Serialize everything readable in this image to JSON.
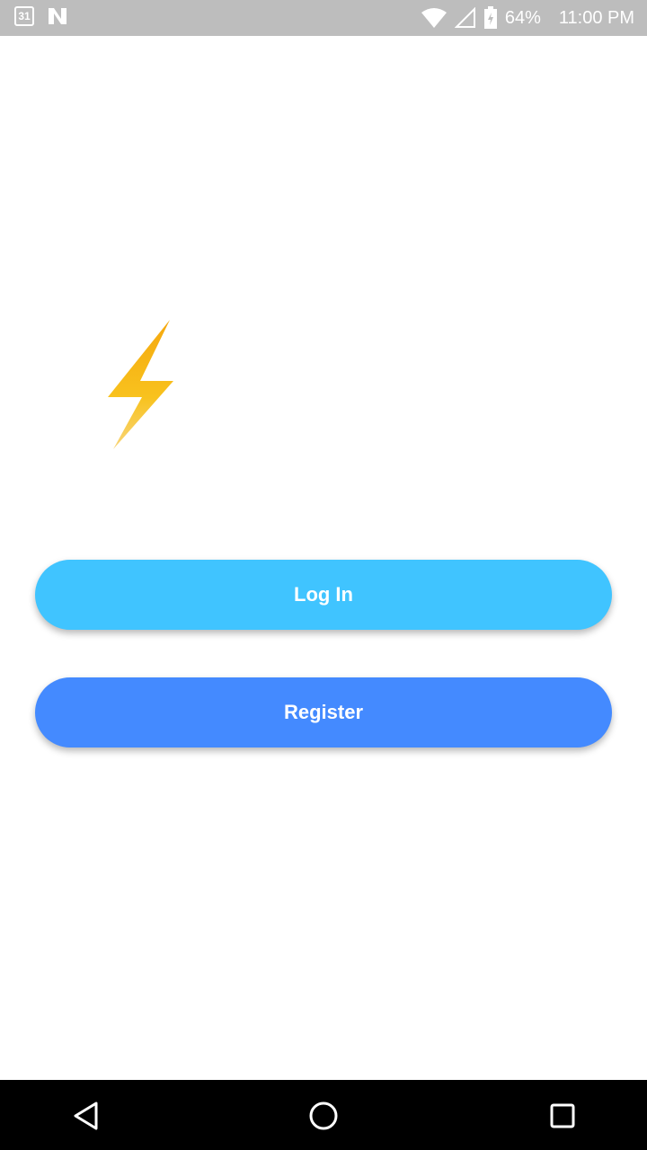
{
  "status_bar": {
    "calendar_day": "31",
    "battery_percent": "64%",
    "time": "11:00 PM",
    "icons": [
      "calendar-icon",
      "n-icon",
      "wifi-icon",
      "signal-icon",
      "battery-icon"
    ]
  },
  "logo": {
    "icon": "lightning-bolt-icon",
    "colors": [
      "#f5b81a",
      "#f7c85a"
    ]
  },
  "buttons": {
    "login_label": "Log In",
    "register_label": "Register"
  },
  "nav_bar": {
    "icons": [
      "back-icon",
      "home-icon",
      "recents-icon"
    ]
  },
  "colors": {
    "login": "#40c4ff",
    "register": "#448aff",
    "status_bar": "#bdbdbd"
  }
}
